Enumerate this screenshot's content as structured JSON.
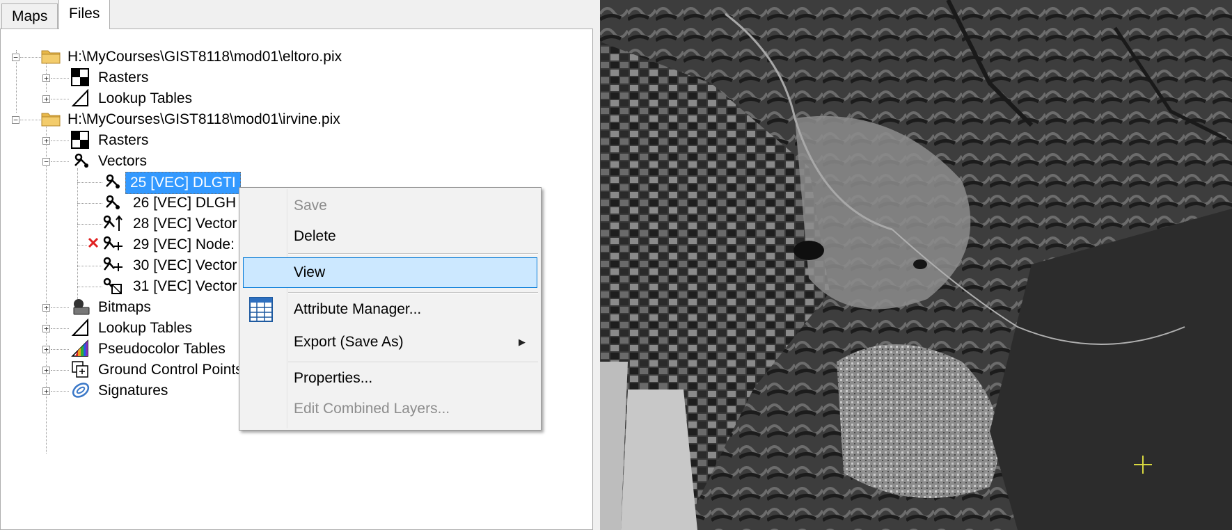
{
  "tabs": [
    {
      "label": "Maps"
    },
    {
      "label": "Files"
    }
  ],
  "tree": {
    "file1": {
      "path": "H:\\MyCourses\\GIST8118\\mod01\\eltoro.pix",
      "rasters": "Rasters",
      "lookup": "Lookup Tables"
    },
    "file2": {
      "path": "H:\\MyCourses\\GIST8118\\mod01\\irvine.pix",
      "rasters": "Rasters",
      "vectors": "Vectors",
      "vector_items": [
        "25 [VEC] DLGTI",
        "26 [VEC] DLGH",
        "28 [VEC] Vector",
        "29 [VEC] Node:",
        "30 [VEC] Vector",
        "31 [VEC] Vector"
      ],
      "bitmaps": "Bitmaps",
      "lookup": "Lookup Tables",
      "pseudocolor": "Pseudocolor Tables",
      "gcp": "Ground Control Points",
      "signatures": "Signatures"
    }
  },
  "context_menu": {
    "save": "Save",
    "delete": "Delete",
    "view": "View",
    "attribute_manager": "Attribute Manager...",
    "export": "Export (Save As)",
    "properties": "Properties...",
    "edit_combined": "Edit Combined Layers..."
  },
  "colors": {
    "selection": "#3399ff",
    "menu_highlight": "#cce8ff",
    "menu_highlight_border": "#0078d7",
    "cursor": "#d8d840"
  }
}
